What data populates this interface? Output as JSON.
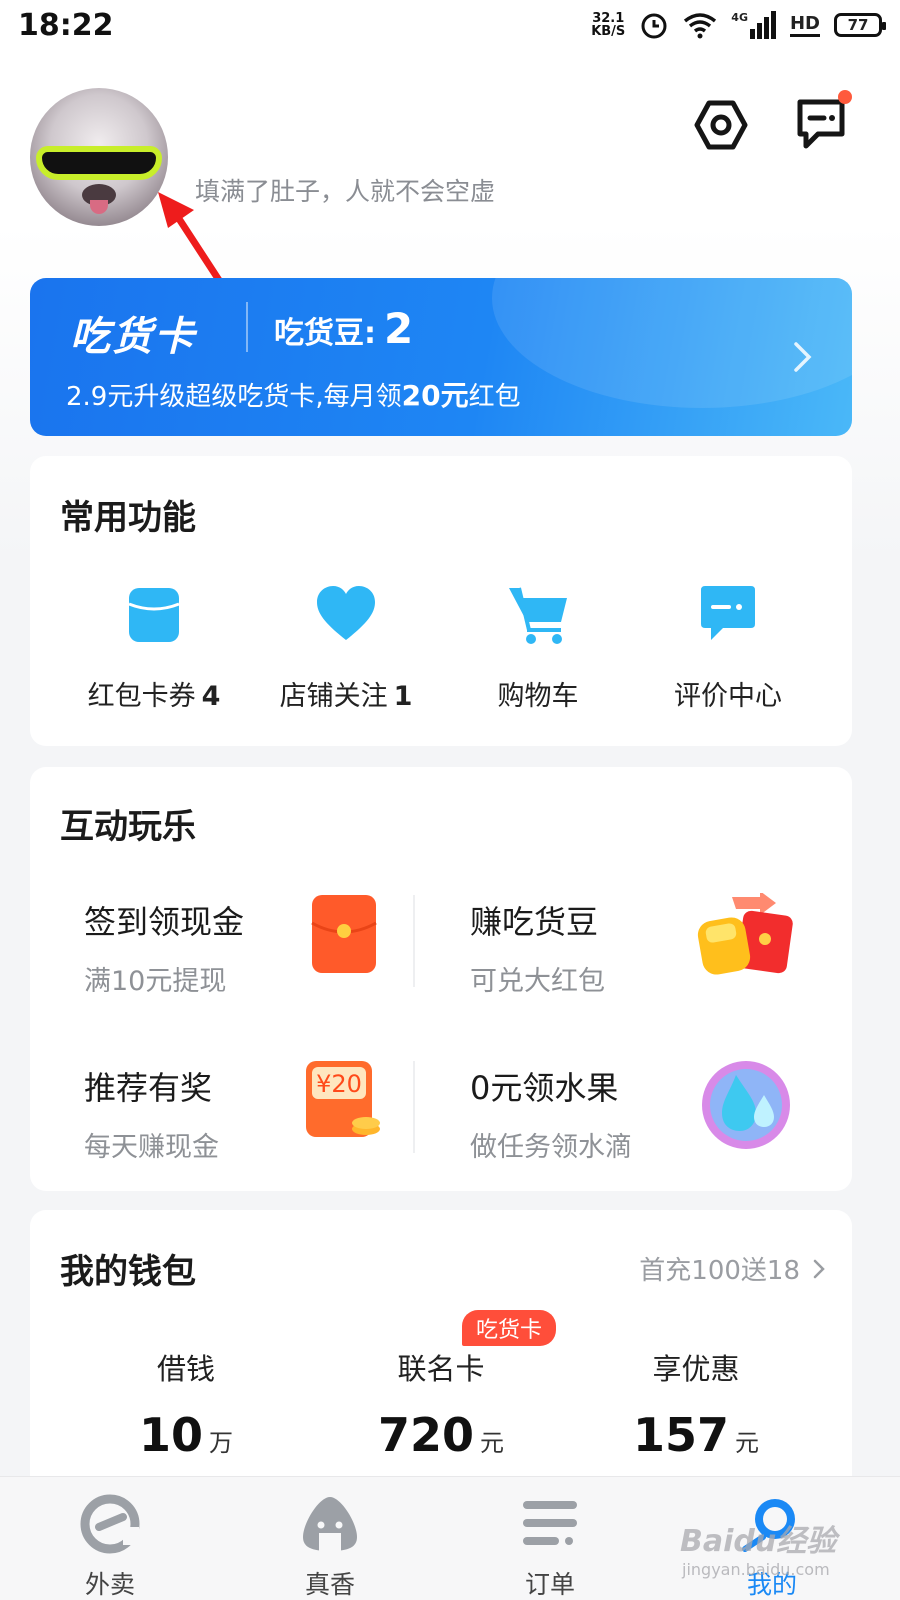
{
  "status_bar": {
    "time": "18:22",
    "net_speed_value": "32.1",
    "net_speed_unit": "KB/S",
    "network_type": "4G",
    "hd": "HD",
    "battery": "77"
  },
  "profile": {
    "motto": "填满了肚子，人就不会空虚"
  },
  "foodie_card": {
    "title": "吃货卡",
    "beans_label": "吃货豆:",
    "beans_count": "2",
    "promo_prefix": "2.9元升级超级吃货卡,每月领",
    "promo_amount": "20元",
    "promo_suffix": "红包"
  },
  "common_functions": {
    "title": "常用功能",
    "items": [
      {
        "label": "红包卡券",
        "count": "4",
        "icon": "wallet-icon"
      },
      {
        "label": "店铺关注",
        "count": "1",
        "icon": "heart-icon"
      },
      {
        "label": "购物车",
        "count": "",
        "icon": "cart-icon"
      },
      {
        "label": "评价中心",
        "count": "",
        "icon": "comment-icon"
      }
    ]
  },
  "interactive": {
    "title": "互动玩乐",
    "items": [
      {
        "name": "签到领现金",
        "desc": "满10元提现",
        "icon": "red-envelope-icon"
      },
      {
        "name": "赚吃货豆",
        "desc": "可兑大红包",
        "icon": "beans-gift-icon"
      },
      {
        "name": "推荐有奖",
        "desc": "每天赚现金",
        "icon": "coupon-20-icon",
        "icon_text": "¥20"
      },
      {
        "name": "0元领水果",
        "desc": "做任务领水滴",
        "icon": "water-drop-icon"
      }
    ]
  },
  "wallet": {
    "title": "我的钱包",
    "promo": "首充100送18",
    "badge": "吃货卡",
    "items": [
      {
        "label": "借钱",
        "value": "10",
        "unit": "万"
      },
      {
        "label": "联名卡",
        "value": "720",
        "unit": "元"
      },
      {
        "label": "享优惠",
        "value": "157",
        "unit": "元"
      }
    ]
  },
  "tabs": [
    {
      "label": "外卖",
      "icon": "takeout-icon"
    },
    {
      "label": "真香",
      "icon": "onigiri-icon"
    },
    {
      "label": "订单",
      "icon": "list-icon"
    },
    {
      "label": "我的",
      "icon": "profile-icon",
      "active": true
    }
  ],
  "watermark": {
    "brand": "Baidu经验",
    "url": "jingyan.baidu.com"
  },
  "colors": {
    "accent": "#1a89f5",
    "card_blue": "#1e86f4",
    "badge_red": "#ff4e3a"
  }
}
